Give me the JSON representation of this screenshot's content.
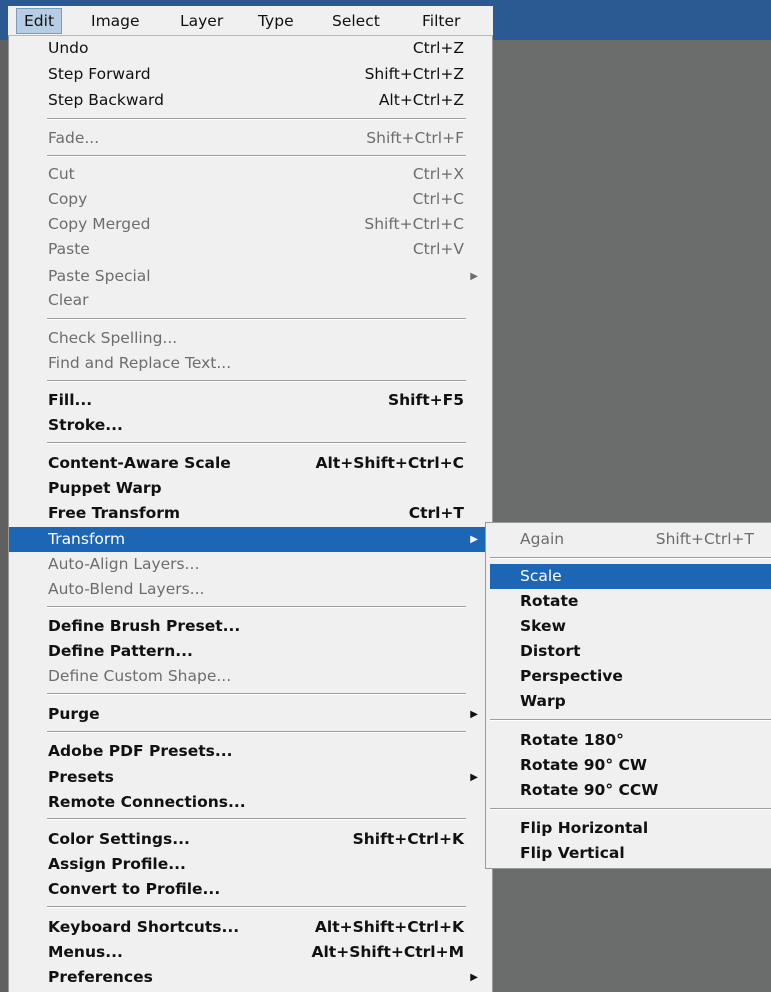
{
  "menubar": {
    "edit": "Edit",
    "image": "Image",
    "layer": "Layer",
    "type": "Type",
    "select": "Select",
    "filter": "Filter"
  },
  "edit_menu": {
    "undo": {
      "label": "Undo",
      "shortcut": "Ctrl+Z"
    },
    "step_forward": {
      "label": "Step Forward",
      "shortcut": "Shift+Ctrl+Z"
    },
    "step_backward": {
      "label": "Step Backward",
      "shortcut": "Alt+Ctrl+Z"
    },
    "fade": {
      "label": "Fade...",
      "shortcut": "Shift+Ctrl+F"
    },
    "cut": {
      "label": "Cut",
      "shortcut": "Ctrl+X"
    },
    "copy": {
      "label": "Copy",
      "shortcut": "Ctrl+C"
    },
    "copy_merged": {
      "label": "Copy Merged",
      "shortcut": "Shift+Ctrl+C"
    },
    "paste": {
      "label": "Paste",
      "shortcut": "Ctrl+V"
    },
    "paste_special": {
      "label": "Paste Special"
    },
    "clear": {
      "label": "Clear"
    },
    "check_spelling": {
      "label": "Check Spelling..."
    },
    "find_replace": {
      "label": "Find and Replace Text..."
    },
    "fill": {
      "label": "Fill...",
      "shortcut": "Shift+F5"
    },
    "stroke": {
      "label": "Stroke..."
    },
    "content_aware_scale": {
      "label": "Content-Aware Scale",
      "shortcut": "Alt+Shift+Ctrl+C"
    },
    "puppet_warp": {
      "label": "Puppet Warp"
    },
    "free_transform": {
      "label": "Free Transform",
      "shortcut": "Ctrl+T"
    },
    "transform": {
      "label": "Transform"
    },
    "auto_align": {
      "label": "Auto-Align Layers..."
    },
    "auto_blend": {
      "label": "Auto-Blend Layers..."
    },
    "define_brush": {
      "label": "Define Brush Preset..."
    },
    "define_pattern": {
      "label": "Define Pattern..."
    },
    "define_shape": {
      "label": "Define Custom Shape..."
    },
    "purge": {
      "label": "Purge"
    },
    "pdf_presets": {
      "label": "Adobe PDF Presets..."
    },
    "presets": {
      "label": "Presets"
    },
    "remote": {
      "label": "Remote Connections..."
    },
    "color_settings": {
      "label": "Color Settings...",
      "shortcut": "Shift+Ctrl+K"
    },
    "assign_profile": {
      "label": "Assign Profile..."
    },
    "convert_profile": {
      "label": "Convert to Profile..."
    },
    "keyboard_shortcuts": {
      "label": "Keyboard Shortcuts...",
      "shortcut": "Alt+Shift+Ctrl+K"
    },
    "menus": {
      "label": "Menus...",
      "shortcut": "Alt+Shift+Ctrl+M"
    },
    "preferences": {
      "label": "Preferences"
    }
  },
  "transform_submenu": {
    "again": {
      "label": "Again",
      "shortcut": "Shift+Ctrl+T"
    },
    "scale": {
      "label": "Scale"
    },
    "rotate": {
      "label": "Rotate"
    },
    "skew": {
      "label": "Skew"
    },
    "distort": {
      "label": "Distort"
    },
    "perspective": {
      "label": "Perspective"
    },
    "warp": {
      "label": "Warp"
    },
    "rotate_180": {
      "label": "Rotate 180°"
    },
    "rotate_90_cw": {
      "label": "Rotate 90° CW"
    },
    "rotate_90_ccw": {
      "label": "Rotate 90° CCW"
    },
    "flip_h": {
      "label": "Flip Horizontal"
    },
    "flip_v": {
      "label": "Flip Vertical"
    }
  },
  "colors": {
    "highlight": "#1d66b6",
    "menu_bg": "#f0f0f0",
    "workspace": "#5f6161",
    "title_strip": "#2b5a92"
  }
}
